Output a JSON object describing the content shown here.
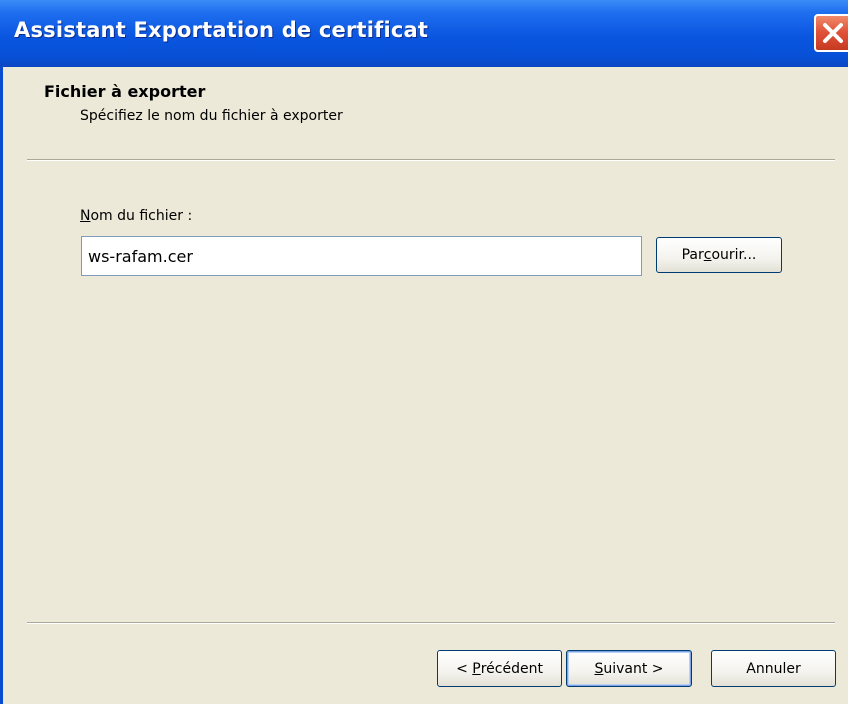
{
  "window": {
    "title": "Assistant Exportation de certificat"
  },
  "header": {
    "title": "Fichier à exporter",
    "subtitle": "Spécifiez le nom du fichier à exporter"
  },
  "form": {
    "label_first": "N",
    "label_rest": "om du fichier :",
    "filename_value": "ws-rafam.cer",
    "browse_pre": "Par",
    "browse_ul": "c",
    "browse_post": "ourir..."
  },
  "footer": {
    "prev_pre": "< ",
    "prev_ul": "P",
    "prev_post": "récédent",
    "next_ul": "S",
    "next_post": "uivant >",
    "cancel_label": "Annuler"
  },
  "icons": {
    "close": "close-icon"
  },
  "colors": {
    "titlebar": "#0a56e0",
    "dialog_bg": "#ece9d8",
    "close_button": "#e2543a",
    "button_border": "#003c74"
  }
}
